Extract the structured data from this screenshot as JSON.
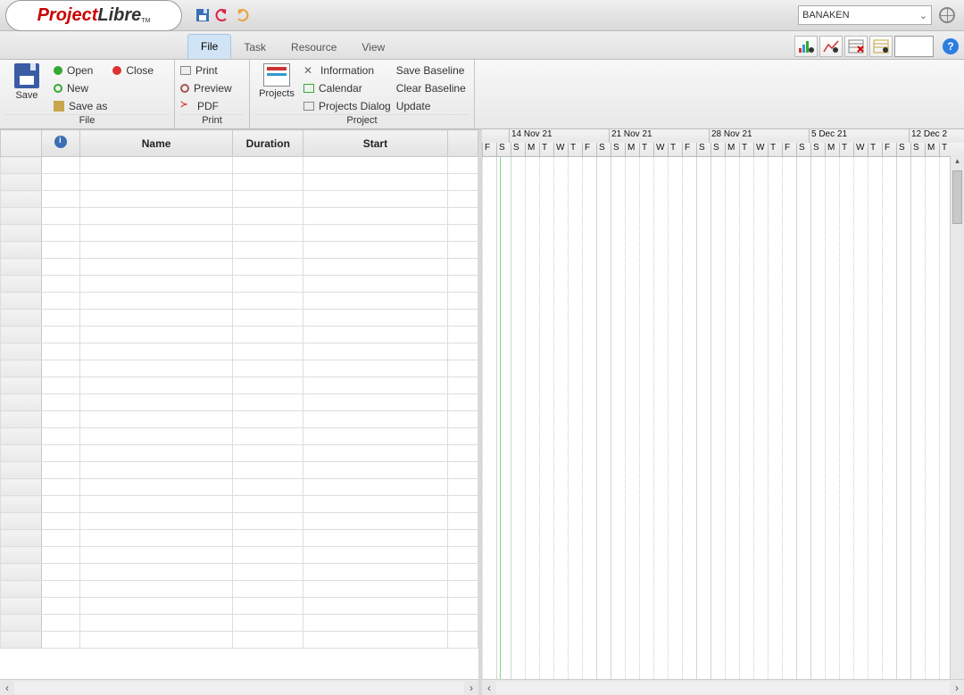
{
  "app": {
    "logo_left": "Project",
    "logo_right": "Libre",
    "logo_tm": "TM"
  },
  "qat": {
    "save": "save",
    "undo": "undo",
    "redo": "redo"
  },
  "topright": {
    "combo_value": "BANAKEN"
  },
  "tabs": {
    "file": "File",
    "task": "Task",
    "resource": "Resource",
    "view": "View"
  },
  "ribbon": {
    "file_group": {
      "label": "File",
      "save": "Save",
      "open": "Open",
      "new": "New",
      "saveas": "Save as",
      "close": "Close"
    },
    "print_group": {
      "label": "Print",
      "print": "Print",
      "preview": "Preview",
      "pdf": "PDF"
    },
    "project_group": {
      "label": "Project",
      "projects": "Projects",
      "information": "Information",
      "calendar": "Calendar",
      "projects_dialog": "Projects Dialog",
      "save_baseline": "Save Baseline",
      "clear_baseline": "Clear Baseline",
      "update": "Update"
    }
  },
  "table": {
    "columns": {
      "info": "",
      "name": "Name",
      "duration": "Duration",
      "start": "Start"
    },
    "row_count": 29
  },
  "timeline": {
    "top": [
      "",
      "14 Nov 21",
      "21 Nov 21",
      "28 Nov 21",
      "5 Dec 21",
      "12 Dec 2"
    ],
    "days": [
      "F",
      "S",
      "S",
      "M",
      "T",
      "W",
      "T",
      "F",
      "S",
      "S",
      "M",
      "T",
      "W",
      "T",
      "F",
      "S",
      "S",
      "M",
      "T",
      "W",
      "T",
      "F",
      "S",
      "S",
      "M",
      "T",
      "W",
      "T",
      "F",
      "S",
      "S",
      "M",
      "T"
    ]
  }
}
